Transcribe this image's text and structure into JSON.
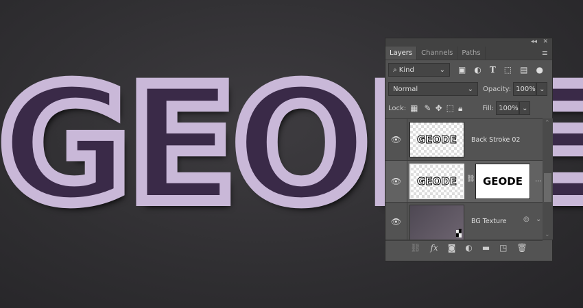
{
  "canvas": {
    "artwork_text": "GEODE"
  },
  "panel": {
    "tabs": [
      {
        "label": "Layers",
        "active": true
      },
      {
        "label": "Channels"
      },
      {
        "label": "Paths"
      }
    ],
    "filter": {
      "kind_label": "Kind"
    },
    "blend_mode": "Normal",
    "opacity_label": "Opacity:",
    "opacity_value": "100%",
    "lock_label": "Lock:",
    "fill_label": "Fill:",
    "fill_value": "100%",
    "layers": [
      {
        "name": "Back Stroke 02",
        "thumb_text": "GEODE",
        "visible": true
      },
      {
        "name": "",
        "thumb_text": "GEODE",
        "mask_text": "GEODE",
        "visible": true,
        "selected": true
      },
      {
        "name": "BG Texture",
        "visible": true
      }
    ]
  }
}
